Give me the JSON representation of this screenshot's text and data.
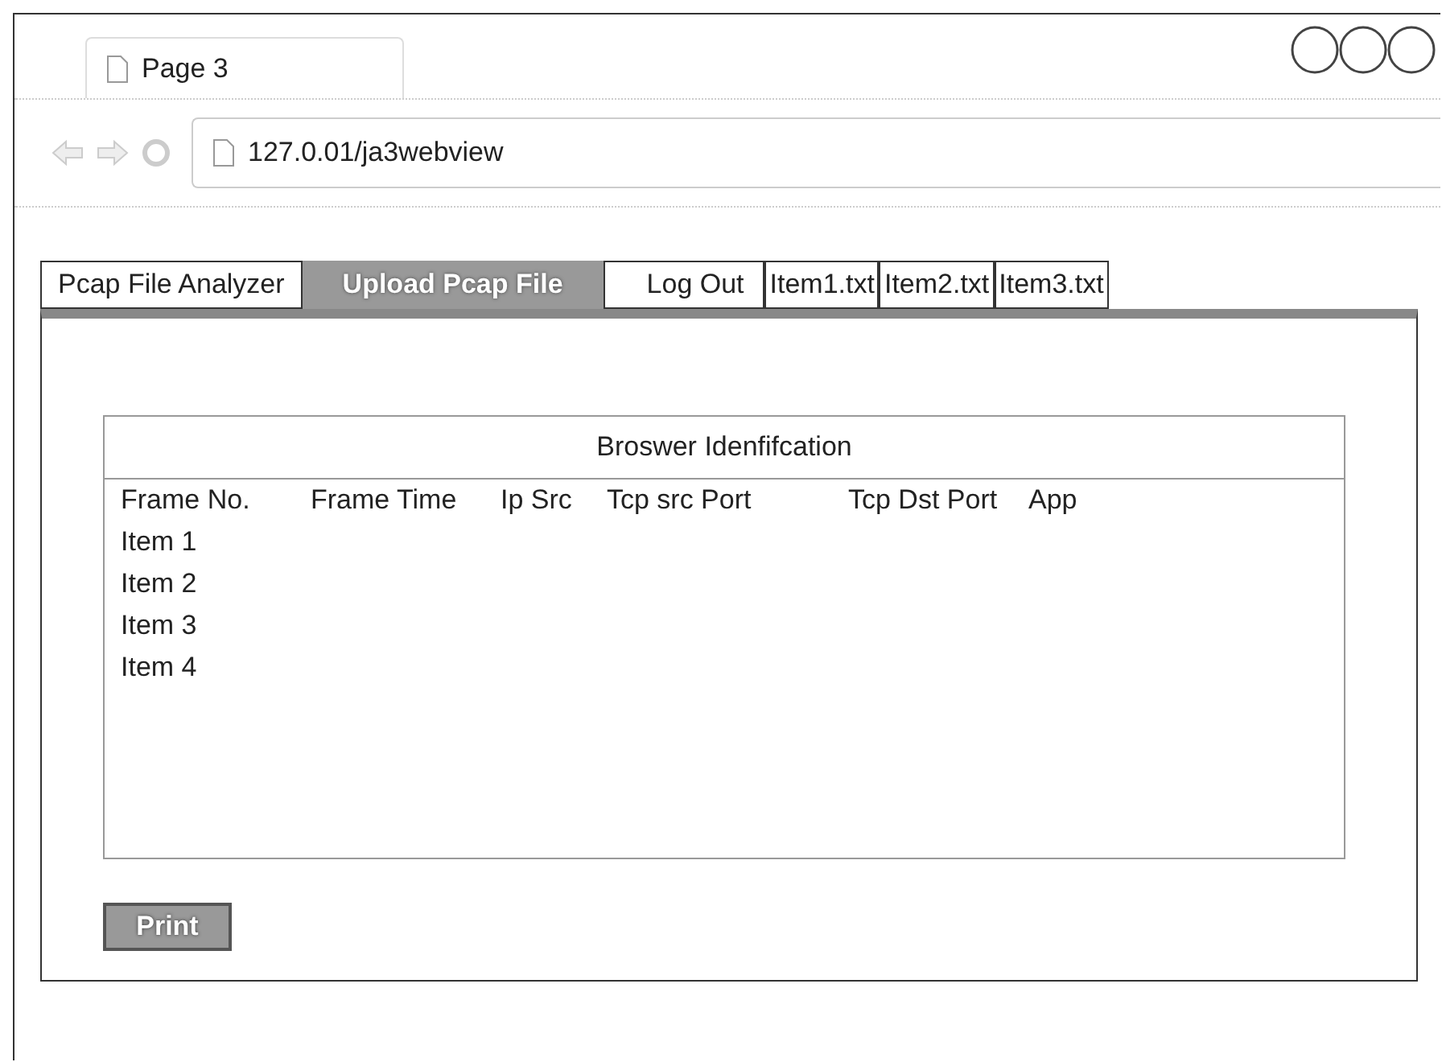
{
  "browser": {
    "tab_title": "Page 3",
    "address": "127.0.01/ja3webview"
  },
  "menu": [
    {
      "label": "Pcap File Analyzer",
      "selected": false
    },
    {
      "label": "Upload Pcap File",
      "selected": true
    },
    {
      "label": "Log Out",
      "selected": false
    },
    {
      "label": "Item1.txt",
      "selected": false
    },
    {
      "label": "Item2.txt",
      "selected": false
    },
    {
      "label": "Item3.txt",
      "selected": false
    }
  ],
  "table": {
    "title": "Broswer Idenfifcation",
    "columns": [
      "Frame No.",
      "Frame Time",
      "Ip Src",
      "Tcp src Port",
      "Tcp Dst Port",
      "App"
    ],
    "rows": [
      "Item 1",
      "Item 2",
      "Item 3",
      "Item 4"
    ]
  },
  "print_button": "Print"
}
